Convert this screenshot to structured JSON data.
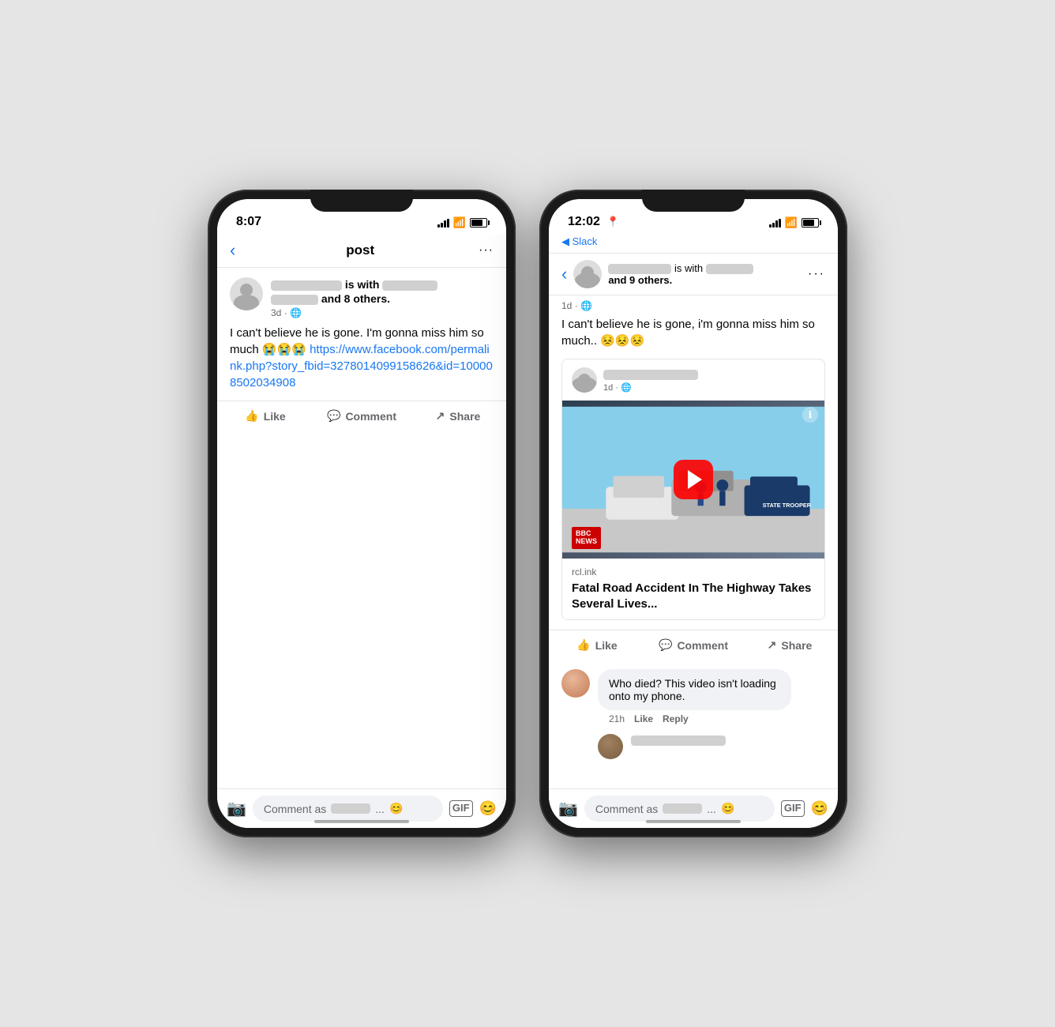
{
  "phone1": {
    "status": {
      "time": "8:07",
      "icons": "signal wifi battery"
    },
    "nav": {
      "back": "‹",
      "title": "post",
      "more": "···"
    },
    "post": {
      "author_is_with": "is with",
      "author_others": "and 8 others.",
      "time": "3d · 🌐",
      "body": "I can't believe he is gone. I'm gonna miss him so much 😭😭😭",
      "link": "https://www.facebook.com/permalink.php?story_fbid=3278014099158626&id=100008502034908"
    },
    "actions": {
      "like": "Like",
      "comment": "Comment",
      "share": "Share"
    },
    "comment_bar": {
      "placeholder": "Comment as",
      "dots": "..."
    }
  },
  "phone2": {
    "status": {
      "time": "12:02",
      "sub_nav": "◀ Slack"
    },
    "nav": {
      "back": "‹",
      "more": "···"
    },
    "post": {
      "author_is_with": "is with",
      "author_others": "and 9 others.",
      "time": "1d · 🌐",
      "body": "I can't believe he is gone, i'm gonna miss him so much.. 😣😣😣"
    },
    "shared_post": {
      "time": "1d · 🌐",
      "link_domain": "rcl.ink",
      "link_title": "Fatal Road Accident In The Highway Takes Several Lives..."
    },
    "actions": {
      "like": "Like",
      "comment": "Comment",
      "share": "Share"
    },
    "comment": {
      "text": "Who died? This video isn't loading onto my phone.",
      "time": "21h",
      "like": "Like",
      "reply": "Reply"
    },
    "comment_bar": {
      "placeholder": "Comment as",
      "dots": "..."
    }
  }
}
